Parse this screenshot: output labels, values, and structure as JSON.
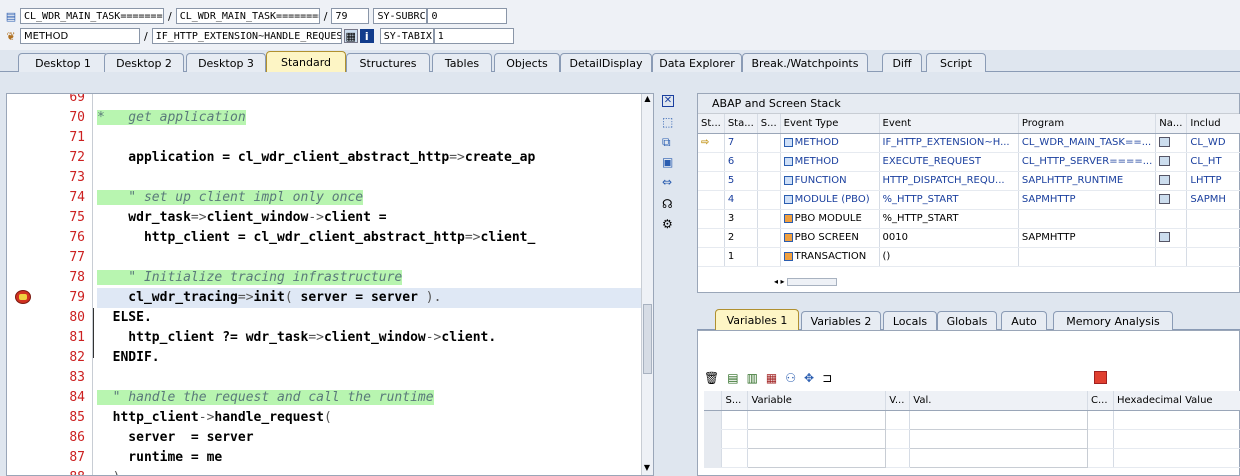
{
  "header": {
    "row1": {
      "prog1": "CL_WDR_MAIN_TASK=============",
      "prog2": "CL_WDR_MAIN_TASK=============",
      "line": "79",
      "var": "SY-SUBRC",
      "val": "0"
    },
    "row2": {
      "kind": "METHOD",
      "event": "IF_HTTP_EXTENSION~HANDLE_REQUEST (CL_WDR_M...",
      "var": "SY-TABIX",
      "val": "1"
    }
  },
  "tabs": [
    "Desktop 1",
    "Desktop 2",
    "Desktop 3",
    "Standard",
    "Structures",
    "Tables",
    "Objects",
    "DetailDisplay",
    "Data Explorer",
    "Break./Watchpoints",
    "Diff",
    "Script"
  ],
  "active_tab": "Standard",
  "code": {
    "lines": [
      {
        "n": "69",
        "parts": []
      },
      {
        "n": "70",
        "parts": [
          {
            "t": "*   get application",
            "c": "cm"
          }
        ]
      },
      {
        "n": "71",
        "parts": []
      },
      {
        "n": "72",
        "parts": [
          {
            "t": "    application = cl_wdr_client_abstract_http",
            "c": "kw"
          },
          {
            "t": "=>",
            "c": "op"
          },
          {
            "t": "create_ap",
            "c": "kw"
          }
        ]
      },
      {
        "n": "73",
        "parts": []
      },
      {
        "n": "74",
        "parts": [
          {
            "t": "    \" set up client impl only once",
            "c": "cm"
          }
        ]
      },
      {
        "n": "75",
        "parts": [
          {
            "t": "    wdr_task",
            "c": "kw"
          },
          {
            "t": "=>",
            "c": "op"
          },
          {
            "t": "client_window",
            "c": "kw"
          },
          {
            "t": "->",
            "c": "op"
          },
          {
            "t": "client =",
            "c": "kw"
          }
        ]
      },
      {
        "n": "76",
        "parts": [
          {
            "t": "      http_client = cl_wdr_client_abstract_http",
            "c": "kw"
          },
          {
            "t": "=>",
            "c": "op"
          },
          {
            "t": "client_",
            "c": "kw"
          }
        ]
      },
      {
        "n": "77",
        "parts": []
      },
      {
        "n": "78",
        "parts": [
          {
            "t": "    \" Initialize tracing infrastructure",
            "c": "cm"
          }
        ]
      },
      {
        "n": "79",
        "parts": [
          {
            "t": "    cl_wdr_tracing",
            "c": "kw"
          },
          {
            "t": "=>",
            "c": "op"
          },
          {
            "t": "init",
            "c": "kw"
          },
          {
            "t": "( ",
            "c": "op"
          },
          {
            "t": "server = server ",
            "c": "kw"
          },
          {
            "t": ").",
            "c": "op"
          }
        ]
      },
      {
        "n": "80",
        "parts": [
          {
            "t": "  ELSE.",
            "c": "kw"
          }
        ]
      },
      {
        "n": "81",
        "parts": [
          {
            "t": "    http_client ?= wdr_task",
            "c": "kw"
          },
          {
            "t": "=>",
            "c": "op"
          },
          {
            "t": "client_window",
            "c": "kw"
          },
          {
            "t": "->",
            "c": "op"
          },
          {
            "t": "client.",
            "c": "kw"
          }
        ]
      },
      {
        "n": "82",
        "parts": [
          {
            "t": "  ENDIF.",
            "c": "kw"
          }
        ]
      },
      {
        "n": "83",
        "parts": []
      },
      {
        "n": "84",
        "parts": [
          {
            "t": "  \" handle the request and call the runtime",
            "c": "cm"
          }
        ]
      },
      {
        "n": "85",
        "parts": [
          {
            "t": "  http_client",
            "c": "kw"
          },
          {
            "t": "->",
            "c": "op"
          },
          {
            "t": "handle_request",
            "c": "kw"
          },
          {
            "t": "(",
            "c": "op"
          }
        ]
      },
      {
        "n": "86",
        "parts": [
          {
            "t": "    server  = server",
            "c": "kw"
          }
        ]
      },
      {
        "n": "87",
        "parts": [
          {
            "t": "    runtime = me",
            "c": "kw"
          }
        ]
      },
      {
        "n": "88",
        "parts": [
          {
            "t": "  ).",
            "c": "op"
          }
        ]
      }
    ]
  },
  "stack": {
    "title": "ABAP and Screen Stack",
    "columns": [
      "St...",
      "Sta...",
      "S...",
      "Event Type",
      "Event",
      "Program",
      "Na...",
      "Includ"
    ],
    "rows": [
      {
        "st": "⇨",
        "sta": "7",
        "type": "METHOD",
        "event": "IF_HTTP_EXTENSION~H...",
        "program": "CL_WDR_MAIN_TASK==...",
        "incl": "CL_WD",
        "blue": true,
        "nav": true
      },
      {
        "st": "",
        "sta": "6",
        "type": "METHOD",
        "event": "EXECUTE_REQUEST",
        "program": "CL_HTTP_SERVER====...",
        "incl": "CL_HT",
        "blue": true,
        "nav": true
      },
      {
        "st": "",
        "sta": "5",
        "type": "FUNCTION",
        "event": "HTTP_DISPATCH_REQU...",
        "program": "SAPLHTTP_RUNTIME",
        "incl": "LHTTP",
        "blue": true,
        "nav": true
      },
      {
        "st": "",
        "sta": "4",
        "type": "MODULE (PBO)",
        "event": "%_HTTP_START",
        "program": "SAPMHTTP",
        "incl": "SAPMH",
        "blue": true,
        "nav": true
      },
      {
        "st": "",
        "sta": "3",
        "type": "PBO MODULE",
        "event": "%_HTTP_START",
        "program": "",
        "incl": "",
        "blue": false,
        "nav": false
      },
      {
        "st": "",
        "sta": "2",
        "type": "PBO SCREEN",
        "event": "0010",
        "program": "SAPMHTTP",
        "incl": "",
        "blue": false,
        "nav": true
      },
      {
        "st": "",
        "sta": "1",
        "type": "TRANSACTION",
        "event": "()",
        "program": "",
        "incl": "",
        "blue": false,
        "nav": false
      }
    ]
  },
  "var_tabs": [
    "Variables 1",
    "Variables 2",
    "Locals",
    "Globals",
    "Auto",
    "Memory Analysis"
  ],
  "var_table": {
    "columns": [
      "S...",
      "Variable",
      "V...",
      "Val.",
      "C...",
      "Hexadecimal Value"
    ]
  }
}
